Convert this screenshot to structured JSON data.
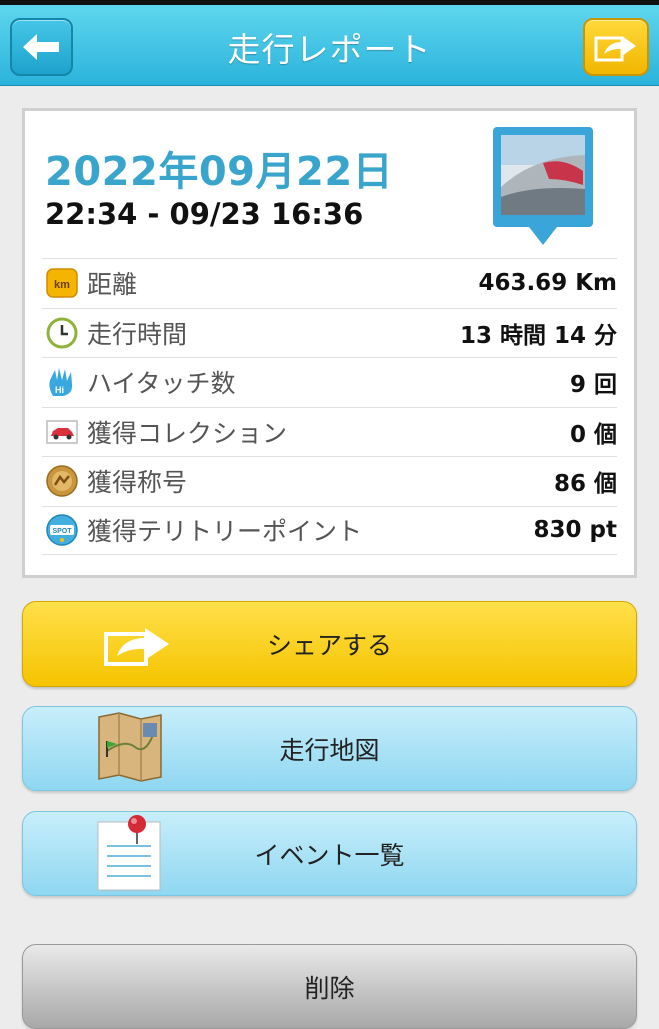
{
  "header": {
    "title": "走行レポート",
    "back_icon": "back-arrow-icon",
    "share_icon": "share-icon"
  },
  "report": {
    "date": "2022年09月22日",
    "time_range": "22:34 - 09/23 16:36",
    "photo_icon": "photo-pin-icon"
  },
  "stats": [
    {
      "icon": "km-icon",
      "label": "距離",
      "value": "463.69 Km"
    },
    {
      "icon": "clock-icon",
      "label": "走行時間",
      "value": "13 時間 14 分"
    },
    {
      "icon": "high-five-icon",
      "label": "ハイタッチ数",
      "value": "9 回"
    },
    {
      "icon": "car-icon",
      "label": "獲得コレクション",
      "value": "0 個"
    },
    {
      "icon": "title-medal-icon",
      "label": "獲得称号",
      "value": "86 個"
    },
    {
      "icon": "spot-icon",
      "label": "獲得テリトリーポイント",
      "value": "830 pt"
    }
  ],
  "buttons": {
    "share": "シェアする",
    "map": "走行地図",
    "events": "イベント一覧",
    "delete": "削除"
  },
  "colors": {
    "header": "#2ab3db",
    "accent_date": "#3aa5cc",
    "share_yellow": "#f5c400",
    "button_blue": "#8fd7f1",
    "delete_gray": "#a8a8a8"
  }
}
